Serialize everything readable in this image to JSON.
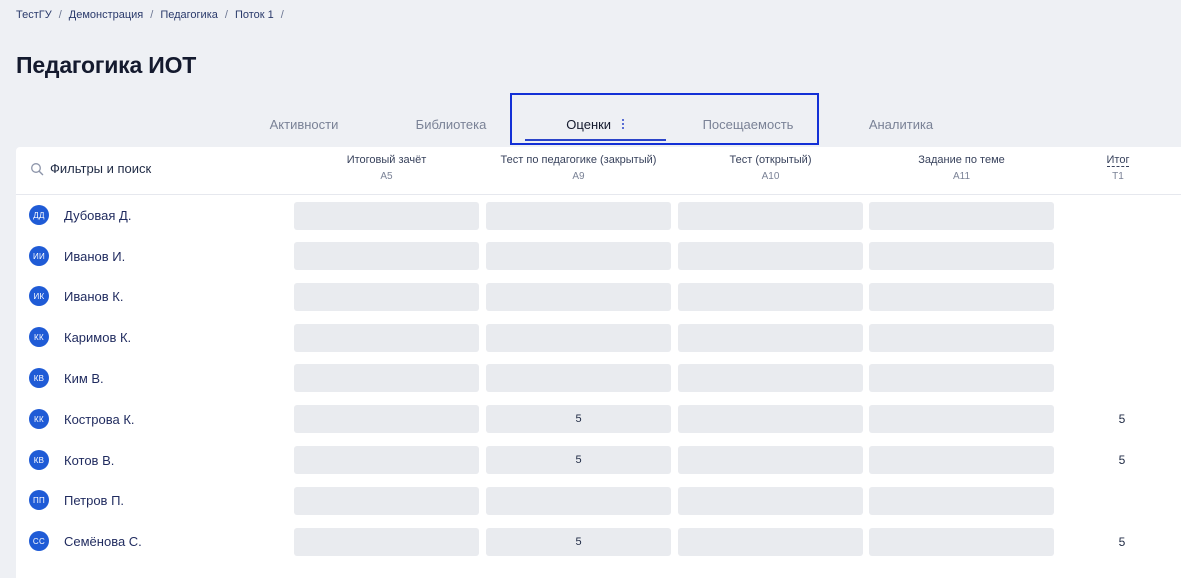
{
  "breadcrumb": [
    {
      "label": "ТестГУ"
    },
    {
      "label": "Демонстрация"
    },
    {
      "label": "Педагогика"
    },
    {
      "label": "Поток 1"
    }
  ],
  "breadcrumb_separator": "/",
  "page_title": "Педагогика ИОТ",
  "tabs": [
    {
      "label": "Активности",
      "active": false
    },
    {
      "label": "Библиотека",
      "active": false
    },
    {
      "label": "Оценки",
      "active": true
    },
    {
      "label": "Посещаемость",
      "active": false
    },
    {
      "label": "Аналитика",
      "active": false
    }
  ],
  "search": {
    "label": "Фильтры и поиск"
  },
  "columns": [
    {
      "title": "Итоговый зачёт",
      "code": "A5"
    },
    {
      "title": "Тест по педагогике (закрытый)",
      "code": "A9"
    },
    {
      "title": "Тест (открытый)",
      "code": "A10"
    },
    {
      "title": "Задание по теме",
      "code": "A11"
    }
  ],
  "total_column": {
    "title": "Итог",
    "code": "T1"
  },
  "students": [
    {
      "initials": "ДД",
      "name": "Дубовая Д.",
      "grades": [
        "",
        "",
        "",
        ""
      ],
      "total": ""
    },
    {
      "initials": "ИИ",
      "name": "Иванов И.",
      "grades": [
        "",
        "",
        "",
        ""
      ],
      "total": ""
    },
    {
      "initials": "ИК",
      "name": "Иванов К.",
      "grades": [
        "",
        "",
        "",
        ""
      ],
      "total": ""
    },
    {
      "initials": "КК",
      "name": "Каримов К.",
      "grades": [
        "",
        "",
        "",
        ""
      ],
      "total": ""
    },
    {
      "initials": "КВ",
      "name": "Ким В.",
      "grades": [
        "",
        "",
        "",
        ""
      ],
      "total": ""
    },
    {
      "initials": "КК",
      "name": "Кострова К.",
      "grades": [
        "",
        "5",
        "",
        ""
      ],
      "total": "5"
    },
    {
      "initials": "КВ",
      "name": "Котов В.",
      "grades": [
        "",
        "5",
        "",
        ""
      ],
      "total": "5"
    },
    {
      "initials": "ПП",
      "name": "Петров П.",
      "grades": [
        "",
        "",
        "",
        ""
      ],
      "total": ""
    },
    {
      "initials": "СС",
      "name": "Семёнова С.",
      "grades": [
        "",
        "5",
        "",
        ""
      ],
      "total": "5"
    }
  ],
  "colors": {
    "accent": "#2b44c9",
    "highlight_box": "#1330d6",
    "avatar": "#1f5bd6"
  }
}
